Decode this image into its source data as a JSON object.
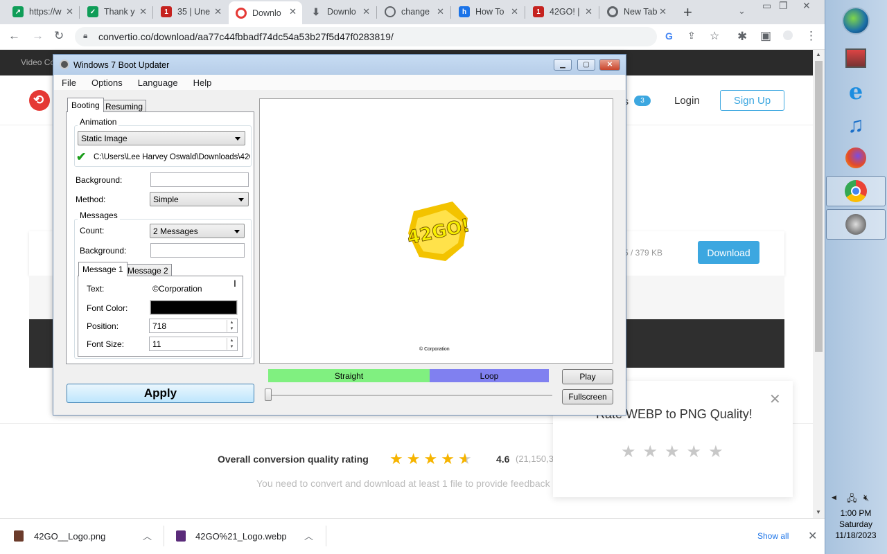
{
  "browser": {
    "tabs": [
      {
        "title": "https://w",
        "icon": "green-arrow-icon",
        "color": "#0f9d58"
      },
      {
        "title": "Thank y",
        "icon": "green-check-icon",
        "color": "#0f9d58"
      },
      {
        "title": "35 | Une",
        "icon": "number-one-icon",
        "color": "#c5221f"
      },
      {
        "title": "Downlo",
        "icon": "convertio-icon",
        "color": "#e53935"
      },
      {
        "title": "Downlo",
        "icon": "download-icon",
        "color": "#5f6368"
      },
      {
        "title": "change",
        "icon": "globe-icon",
        "color": "#5f6368"
      },
      {
        "title": "How To",
        "icon": "howto-icon",
        "color": "#1a73e8"
      },
      {
        "title": "42GO! |",
        "icon": "number-one-icon",
        "color": "#c5221f"
      },
      {
        "title": "New Tab",
        "icon": "chrome-icon",
        "color": "#5f6368"
      }
    ],
    "url": "convertio.co/download/aa77c44fbbadf74dc54a53b27f5d47f0283819/"
  },
  "page": {
    "topbar_text": "Video Co",
    "badge_count": "3",
    "login": "Login",
    "signup": "Sign Up",
    "file_size": "5 / 379 KB",
    "download_button": "Download",
    "rating_label": "Overall conversion quality rating",
    "rating_value": "4.6",
    "rating_count": "(21,150,3",
    "feedback_note": "You need to convert and download at least 1 file to provide feedback",
    "popup_title": "Rate WEBP to PNG Quality!"
  },
  "dialog": {
    "title": "Windows 7 Boot Updater",
    "menu": [
      "File",
      "Options",
      "Language",
      "Help"
    ],
    "tabs": [
      "Booting",
      "Resuming"
    ],
    "animation_group": "Animation",
    "animation_type": "Static Image",
    "animation_path": "C:\\Users\\Lee Harvey Oswald\\Downloads\\42G",
    "background_label": "Background:",
    "background_value": "",
    "method_label": "Method:",
    "method_value": "Simple",
    "messages_group": "Messages",
    "count_label": "Count:",
    "count_value": "2 Messages",
    "msg_background_label": "Background:",
    "message_tabs": [
      "Message 1",
      "Message 2"
    ],
    "text_label": "Text:",
    "text_value": "©Corporation",
    "font_color_label": "Font Color:",
    "font_color": "#000000",
    "position_label": "Position:",
    "position_value": "718",
    "font_size_label": "Font Size:",
    "font_size_value": "11",
    "apply": "Apply",
    "preview_caption": "© Corporation",
    "logo_text": "42GO!",
    "straight": "Straight",
    "loop": "Loop",
    "straight_color": "#80f080",
    "loop_color": "#8080f0",
    "play": "Play",
    "fullscreen": "Fullscreen"
  },
  "downloads": {
    "items": [
      "42GO__Logo.png",
      "42GO%21_Logo.webp"
    ],
    "show_all": "Show all"
  },
  "taskbar": {
    "time": "1:00 PM",
    "day": "Saturday",
    "date": "11/18/2023"
  }
}
